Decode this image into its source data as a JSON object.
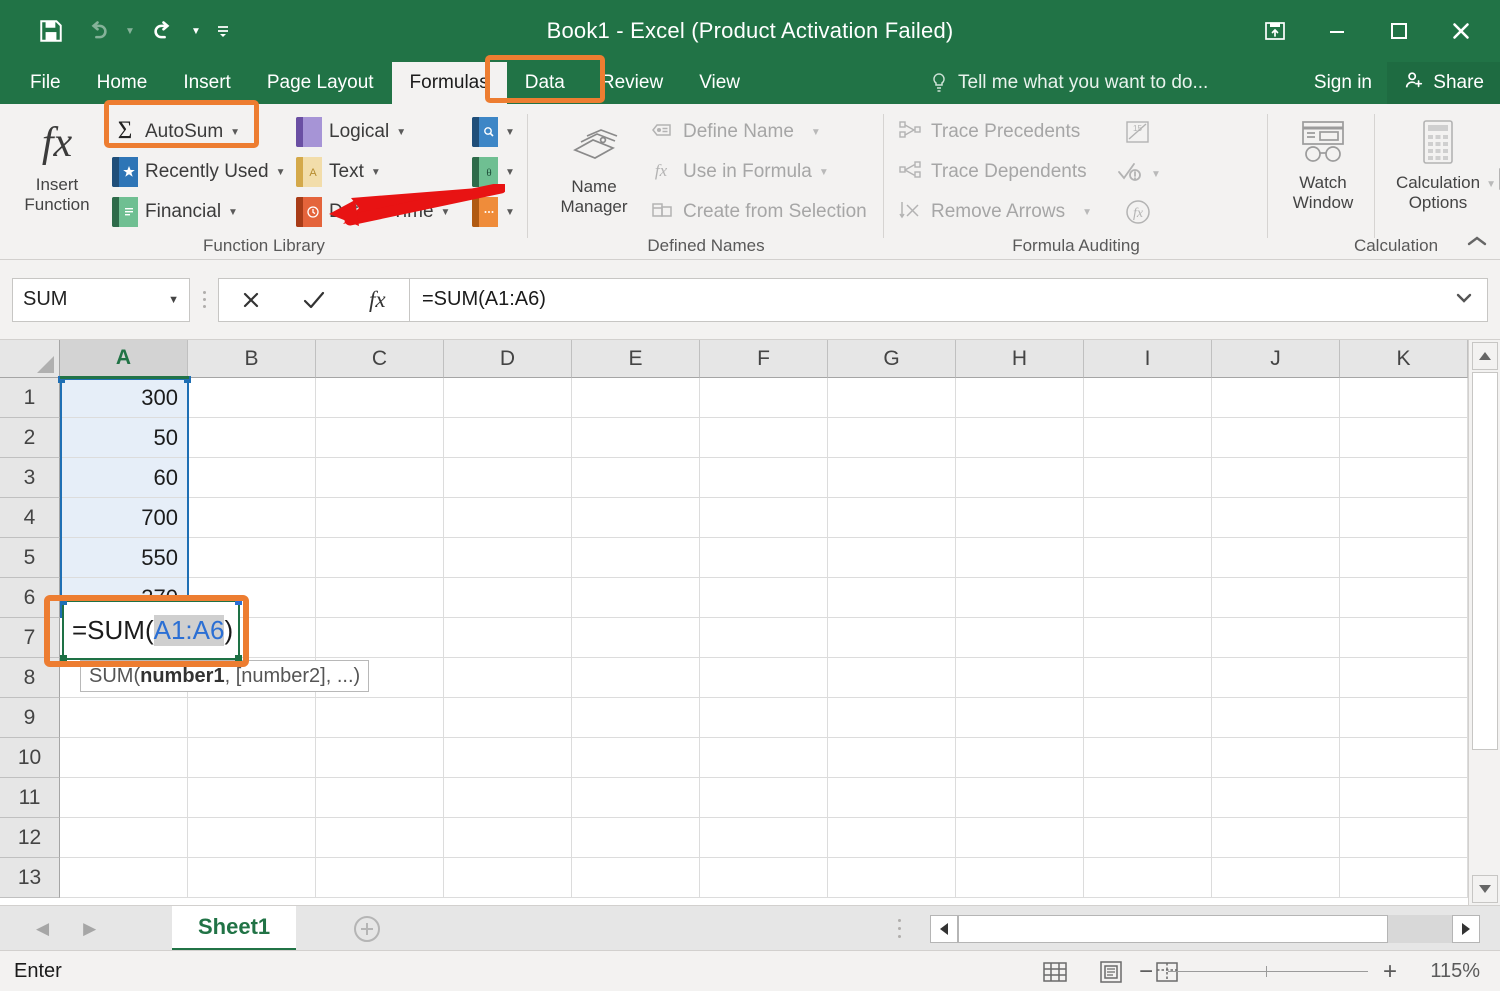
{
  "window": {
    "title": "Book1 - Excel (Product Activation Failed)",
    "quick_access": [
      {
        "name": "save-icon",
        "label": "Save"
      },
      {
        "name": "undo-icon",
        "label": "Undo"
      },
      {
        "name": "redo-icon",
        "label": "Redo"
      },
      {
        "name": "customize-quick-access-icon",
        "label": "Customize Quick Access Toolbar"
      }
    ],
    "controls": [
      {
        "name": "ribbon-display-options-icon",
        "label": "Ribbon Display Options"
      },
      {
        "name": "minimize-icon",
        "label": "Minimize"
      },
      {
        "name": "restore-icon",
        "label": "Restore Down"
      },
      {
        "name": "close-icon",
        "label": "Close"
      }
    ]
  },
  "tabs": [
    {
      "label": "File",
      "active": false
    },
    {
      "label": "Home",
      "active": false
    },
    {
      "label": "Insert",
      "active": false
    },
    {
      "label": "Page Layout",
      "active": false
    },
    {
      "label": "Formulas",
      "active": true
    },
    {
      "label": "Data",
      "active": false
    },
    {
      "label": "Review",
      "active": false
    },
    {
      "label": "View",
      "active": false
    }
  ],
  "tellme": {
    "placeholder": "Tell me what you want to do..."
  },
  "account": {
    "signin": "Sign in",
    "share": "Share"
  },
  "ribbon": {
    "groups": [
      {
        "name": "function-library",
        "label": "Function Library",
        "insert_function": {
          "line1": "Insert",
          "line2": "Function"
        },
        "items": [
          {
            "label": "AutoSum",
            "icon": "sigma-icon",
            "highlighted": true
          },
          {
            "label": "Recently Used",
            "icon": "recently-used-icon"
          },
          {
            "label": "Financial",
            "icon": "financial-icon"
          },
          {
            "label": "Logical",
            "icon": "logical-icon"
          },
          {
            "label": "Text",
            "icon": "text-icon"
          },
          {
            "label": "Date & Time",
            "icon": "date-time-icon"
          },
          {
            "label": "",
            "icon": "lookup-reference-icon"
          },
          {
            "label": "",
            "icon": "math-trig-icon"
          },
          {
            "label": "",
            "icon": "more-functions-icon"
          }
        ]
      },
      {
        "name": "defined-names",
        "label": "Defined Names",
        "name_manager": {
          "line1": "Name",
          "line2": "Manager"
        },
        "items": [
          {
            "label": "Define Name",
            "icon": "define-name-icon"
          },
          {
            "label": "Use in Formula",
            "icon": "use-in-formula-icon"
          },
          {
            "label": "Create from Selection",
            "icon": "create-from-selection-icon"
          }
        ]
      },
      {
        "name": "formula-auditing",
        "label": "Formula Auditing",
        "items": [
          {
            "label": "Trace Precedents",
            "icon": "trace-precedents-icon"
          },
          {
            "label": "Trace Dependents",
            "icon": "trace-dependents-icon"
          },
          {
            "label": "Remove Arrows",
            "icon": "remove-arrows-icon"
          },
          {
            "label": "",
            "icon": "show-formulas-icon"
          },
          {
            "label": "",
            "icon": "error-checking-icon"
          },
          {
            "label": "",
            "icon": "evaluate-formula-icon"
          }
        ]
      },
      {
        "name": "calculation",
        "label": "Calculation",
        "watch_window": {
          "line1": "Watch",
          "line2": "Window"
        },
        "calculation_options": {
          "line1": "Calculation",
          "line2": "Options"
        },
        "items": [
          {
            "label": "",
            "icon": "calculate-now-icon"
          },
          {
            "label": "",
            "icon": "calculate-sheet-icon"
          }
        ]
      }
    ],
    "collapse_label": "Collapse the Ribbon"
  },
  "formula_bar": {
    "name_box": "SUM",
    "cancel_label": "Cancel",
    "enter_label": "Enter",
    "insert_function_label": "Insert Function",
    "formula": "=SUM(A1:A6)",
    "expand_label": "Expand Formula Bar"
  },
  "grid": {
    "columns": [
      "A",
      "B",
      "C",
      "D",
      "E",
      "F",
      "G",
      "H",
      "I",
      "J",
      "K"
    ],
    "selected_column": "A",
    "rows": [
      1,
      2,
      3,
      4,
      5,
      6,
      7,
      8,
      9,
      10,
      11,
      12,
      13
    ],
    "column_a_values": [
      "300",
      "50",
      "60",
      "700",
      "550",
      "370"
    ],
    "active_cell": "A7",
    "editing": {
      "prefix": "=SUM(",
      "argument": "A1:A6",
      "suffix": ")"
    },
    "tooltip": {
      "func": "SUM(",
      "arg1": "number1",
      "rest": ", [number2], ...)"
    },
    "selection_range": "A1:A6"
  },
  "sheet_bar": {
    "prev_label": "Previous Sheet",
    "next_label": "Next Sheet",
    "sheets": [
      {
        "label": "Sheet1",
        "active": true
      }
    ],
    "add_sheet_label": "New sheet"
  },
  "status_bar": {
    "mode": "Enter",
    "views": [
      {
        "name": "normal-view-icon",
        "label": "Normal"
      },
      {
        "name": "page-layout-view-icon",
        "label": "Page Layout"
      },
      {
        "name": "page-break-preview-icon",
        "label": "Page Break Preview"
      }
    ],
    "zoom_out_label": "Zoom Out",
    "zoom_in_label": "Zoom In",
    "zoom_level": "115%"
  },
  "annotations": {
    "highlight_color": "#ED7D31",
    "arrow_color": "#E81313",
    "brand_color": "#217346"
  }
}
